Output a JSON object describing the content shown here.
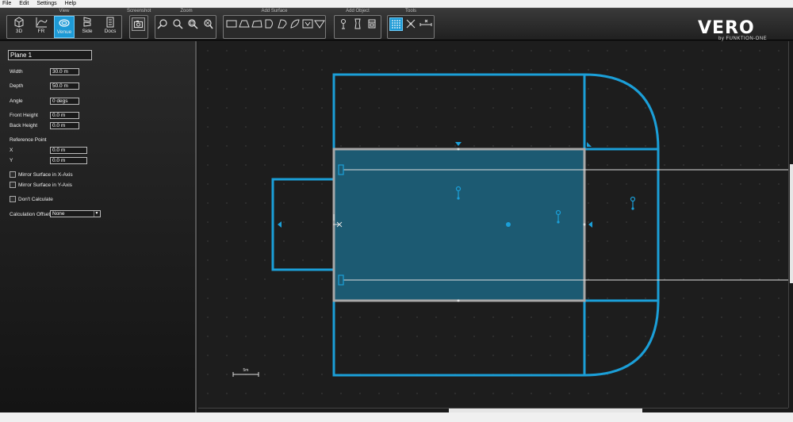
{
  "menu": [
    "File",
    "Edit",
    "Settings",
    "Help"
  ],
  "toolbar": {
    "groups": {
      "view": "View",
      "screenshot": "Screenshot",
      "zoom": "Zoom",
      "add_surface": "Add Surface",
      "add_object": "Add Object",
      "tools": "Tools"
    },
    "view_buttons": [
      "3D",
      "FR",
      "Venue",
      "Side",
      "Docs"
    ],
    "active_view": "Venue",
    "logo": "VERO",
    "logo_sub": "by FUNKTION-ONE"
  },
  "panel": {
    "name": "Plane 1",
    "width_label": "Width",
    "width_value": "30.0 m",
    "depth_label": "Depth",
    "depth_value": "50.0 m",
    "angle_label": "Angle",
    "angle_value": "0 degs",
    "front_height_label": "Front Height",
    "front_height_value": "0.0 m",
    "back_height_label": "Back Height",
    "back_height_value": "0.0 m",
    "reference_point_label": "Reference Point",
    "x_label": "X",
    "x_value": "0.0 m",
    "y_label": "Y",
    "y_value": "0.0 m",
    "mirror_x_label": "Mirror Surface in X-Axis",
    "mirror_y_label": "Mirror Surface in Y-Axis",
    "dont_calc_label": "Don't Calculate",
    "calc_offset_label": "Calculation Offset",
    "calc_offset_value": "None"
  },
  "canvas": {
    "scale_label": "5m",
    "colors": {
      "surface": "#1b9fd8",
      "selected_fill": "#1c5a72",
      "selected_stroke": "#a8a8a8"
    }
  }
}
